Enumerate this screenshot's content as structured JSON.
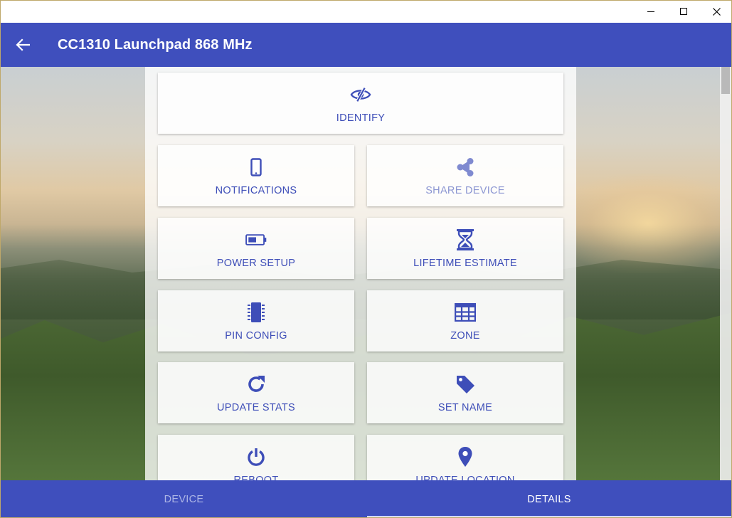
{
  "window": {
    "controls": {
      "minimize": "minimize-icon",
      "maximize": "maximize-icon",
      "close": "close-icon"
    }
  },
  "appbar": {
    "title": "CC1310 Launchpad 868 MHz",
    "back_icon": "arrow-back-icon"
  },
  "tiles": [
    {
      "id": "identify",
      "label": "IDENTIFY",
      "icon": "eye-slash-icon",
      "enabled": true
    },
    {
      "id": "notifications",
      "label": "NOTIFICATIONS",
      "icon": "phone-icon",
      "enabled": true
    },
    {
      "id": "share-device",
      "label": "SHARE DEVICE",
      "icon": "share-icon",
      "enabled": false
    },
    {
      "id": "power-setup",
      "label": "POWER SETUP",
      "icon": "battery-icon",
      "enabled": true
    },
    {
      "id": "lifetime-estimate",
      "label": "LIFETIME ESTIMATE",
      "icon": "hourglass-icon",
      "enabled": true
    },
    {
      "id": "pin-config",
      "label": "PIN CONFIG",
      "icon": "chip-icon",
      "enabled": true
    },
    {
      "id": "zone",
      "label": "ZONE",
      "icon": "grid-icon",
      "enabled": true
    },
    {
      "id": "update-stats",
      "label": "UPDATE STATS",
      "icon": "refresh-icon",
      "enabled": true
    },
    {
      "id": "set-name",
      "label": "SET NAME",
      "icon": "tag-icon",
      "enabled": true
    },
    {
      "id": "reboot",
      "label": "REBOOT",
      "icon": "power-icon",
      "enabled": true
    },
    {
      "id": "update-location",
      "label": "UPDATE LOCATION",
      "icon": "location-pin-icon",
      "enabled": true
    }
  ],
  "tabs": [
    {
      "label": "DEVICE",
      "selected": false
    },
    {
      "label": "DETAILS",
      "selected": true
    }
  ],
  "colors": {
    "primary": "#3f4fbd",
    "accent_text": "#3e4eb8",
    "disabled_text": "#8c96d2"
  }
}
